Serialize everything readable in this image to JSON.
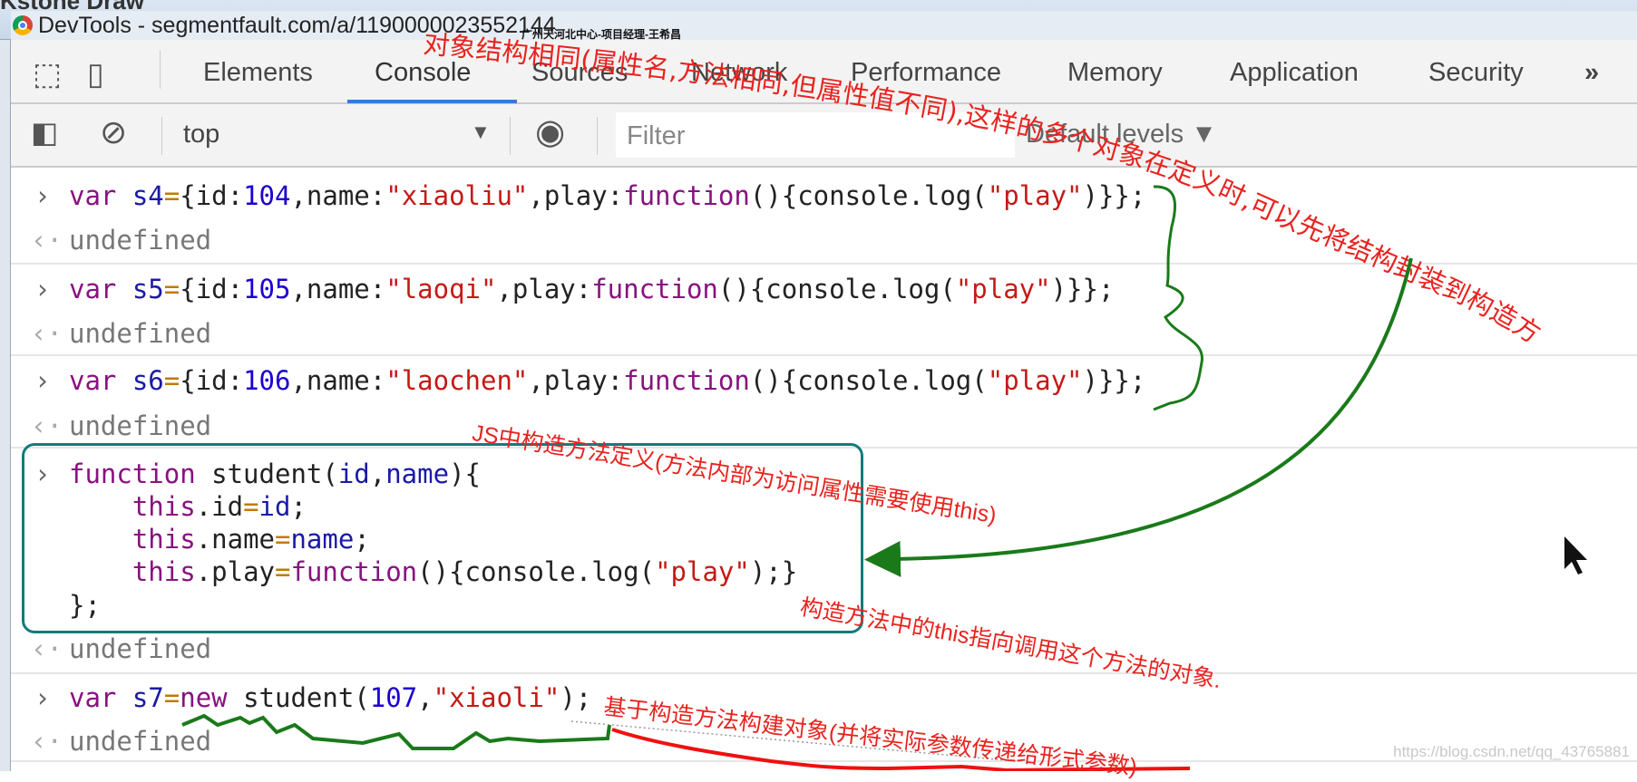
{
  "window": {
    "background_app": "Kstone Draw",
    "title": "DevTools - segmentfault.com/a/1190000023552144",
    "overlay_watermark": "广州天河北中心-项目经理-王希昌"
  },
  "tabs": [
    {
      "label": "Elements"
    },
    {
      "label": "Console",
      "active": true
    },
    {
      "label": "Sources"
    },
    {
      "label": "Network"
    },
    {
      "label": "Performance"
    },
    {
      "label": "Memory"
    },
    {
      "label": "Application"
    },
    {
      "label": "Security"
    }
  ],
  "more_tabs_icon": "»",
  "toolbar": {
    "context": "top",
    "filter_placeholder": "Filter",
    "levels": "Default levels ▼"
  },
  "console": [
    {
      "type": "input",
      "tokens": [
        [
          "var ",
          "kw"
        ],
        [
          "s4",
          "vn"
        ],
        [
          "=",
          "op"
        ],
        [
          "{id:",
          "pl"
        ],
        [
          "104",
          "nm"
        ],
        [
          ",name:",
          "pl"
        ],
        [
          "\"xiaoliu\"",
          "st"
        ],
        [
          ",play:",
          "pl"
        ],
        [
          "function",
          "kw"
        ],
        [
          "(){console.log(",
          "pl"
        ],
        [
          "\"play\"",
          "st"
        ],
        [
          ")}};",
          "pl"
        ]
      ]
    },
    {
      "type": "output",
      "text": "undefined"
    },
    {
      "type": "input",
      "tokens": [
        [
          "var ",
          "kw"
        ],
        [
          "s5",
          "vn"
        ],
        [
          "=",
          "op"
        ],
        [
          "{id:",
          "pl"
        ],
        [
          "105",
          "nm"
        ],
        [
          ",name:",
          "pl"
        ],
        [
          "\"laoqi\"",
          "st"
        ],
        [
          ",play:",
          "pl"
        ],
        [
          "function",
          "kw"
        ],
        [
          "(){console.log(",
          "pl"
        ],
        [
          "\"play\"",
          "st"
        ],
        [
          ")}};",
          "pl"
        ]
      ]
    },
    {
      "type": "output",
      "text": "undefined"
    },
    {
      "type": "input",
      "tokens": [
        [
          "var ",
          "kw"
        ],
        [
          "s6",
          "vn"
        ],
        [
          "=",
          "op"
        ],
        [
          "{id:",
          "pl"
        ],
        [
          "106",
          "nm"
        ],
        [
          ",name:",
          "pl"
        ],
        [
          "\"laochen\"",
          "st"
        ],
        [
          ",play:",
          "pl"
        ],
        [
          "function",
          "kw"
        ],
        [
          "(){console.log(",
          "pl"
        ],
        [
          "\"play\"",
          "st"
        ],
        [
          ")}};",
          "pl"
        ]
      ]
    },
    {
      "type": "output",
      "text": "undefined"
    },
    {
      "type": "input",
      "tokens": [
        [
          "function ",
          "kw"
        ],
        [
          "student",
          "pl"
        ],
        [
          "(",
          "pl"
        ],
        [
          "id",
          "vn"
        ],
        [
          ",",
          "pl"
        ],
        [
          "name",
          "vn"
        ],
        [
          "){",
          "pl"
        ]
      ]
    },
    {
      "type": "cont",
      "tokens": [
        [
          "    this",
          "kw"
        ],
        [
          ".id",
          "pl"
        ],
        [
          "=",
          "op"
        ],
        [
          "id",
          "vn"
        ],
        [
          ";",
          "pl"
        ]
      ]
    },
    {
      "type": "cont",
      "tokens": [
        [
          "    this",
          "kw"
        ],
        [
          ".name",
          "pl"
        ],
        [
          "=",
          "op"
        ],
        [
          "name",
          "vn"
        ],
        [
          ";",
          "pl"
        ]
      ]
    },
    {
      "type": "cont",
      "tokens": [
        [
          "    this",
          "kw"
        ],
        [
          ".play",
          "pl"
        ],
        [
          "=",
          "op"
        ],
        [
          "function",
          "kw"
        ],
        [
          "(){console.log(",
          "pl"
        ],
        [
          "\"play\"",
          "st"
        ],
        [
          ");}",
          "pl"
        ]
      ]
    },
    {
      "type": "cont",
      "tokens": [
        [
          "};",
          "pl"
        ]
      ]
    },
    {
      "type": "output",
      "text": "undefined"
    },
    {
      "type": "input",
      "tokens": [
        [
          "var ",
          "kw"
        ],
        [
          "s7",
          "vn"
        ],
        [
          "=",
          "op"
        ],
        [
          "new ",
          "kw"
        ],
        [
          "student(",
          "pl"
        ],
        [
          "107",
          "nm"
        ],
        [
          ",",
          "pl"
        ],
        [
          "\"xiaoli\"",
          "st"
        ],
        [
          ");",
          "pl"
        ]
      ]
    },
    {
      "type": "output",
      "text": "undefined"
    }
  ],
  "annotations": {
    "a1": "对象结构相同(属性名,方法相同,但属性值不同),这样的多个对象在定义时,可以先将结构封装到构造方法",
    "a2": "JS中构造方法定义(方法内部为访问属性需要使用this)",
    "a3": "构造方法中的this指向调用这个方法的对象.",
    "a4": "基于构造方法构建对象(并将实际参数传递给形式参数)"
  },
  "colors": {
    "annotation_red": "#e8231f",
    "annotation_green": "#1a7a1a",
    "box_teal": "#167a7a",
    "active_tab": "#3879d9"
  },
  "watermark": "https://blog.csdn.net/qq_43765881"
}
